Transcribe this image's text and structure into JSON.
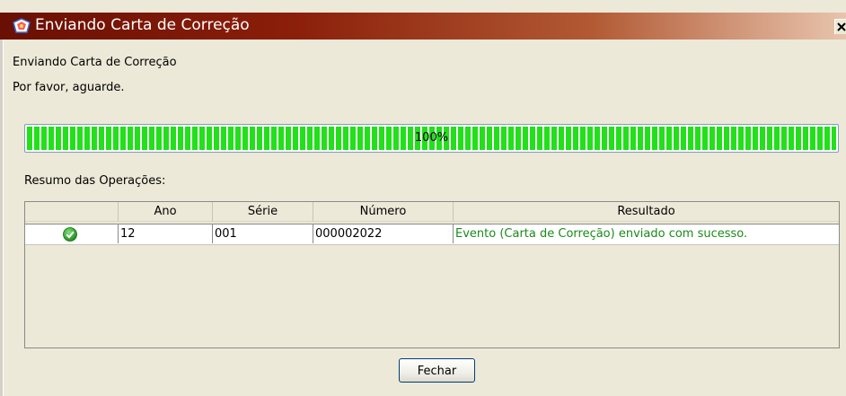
{
  "window": {
    "title": "Enviando Carta de Correção",
    "close_glyph": "✕",
    "title_gradient": [
      "#6a0f04",
      "#e8c4ad"
    ]
  },
  "messages": {
    "line1": "Enviando Carta de Correção",
    "line2": "Por favor, aguarde."
  },
  "progress": {
    "label": "100%",
    "value": 1.0,
    "fill_color": "#22e01a"
  },
  "summary": {
    "label": "Resumo das Operações:",
    "columns": [
      "",
      "Ano",
      "Série",
      "Número",
      "Resultado"
    ],
    "rows": [
      {
        "status_icon": "success-check-icon",
        "ano": "12",
        "serie": "001",
        "numero": "000002022",
        "resultado": "Evento (Carta de Correção) enviado com sucesso.",
        "resultado_color": "#1a8a1a"
      }
    ]
  },
  "footer": {
    "close_button": "Fechar"
  }
}
